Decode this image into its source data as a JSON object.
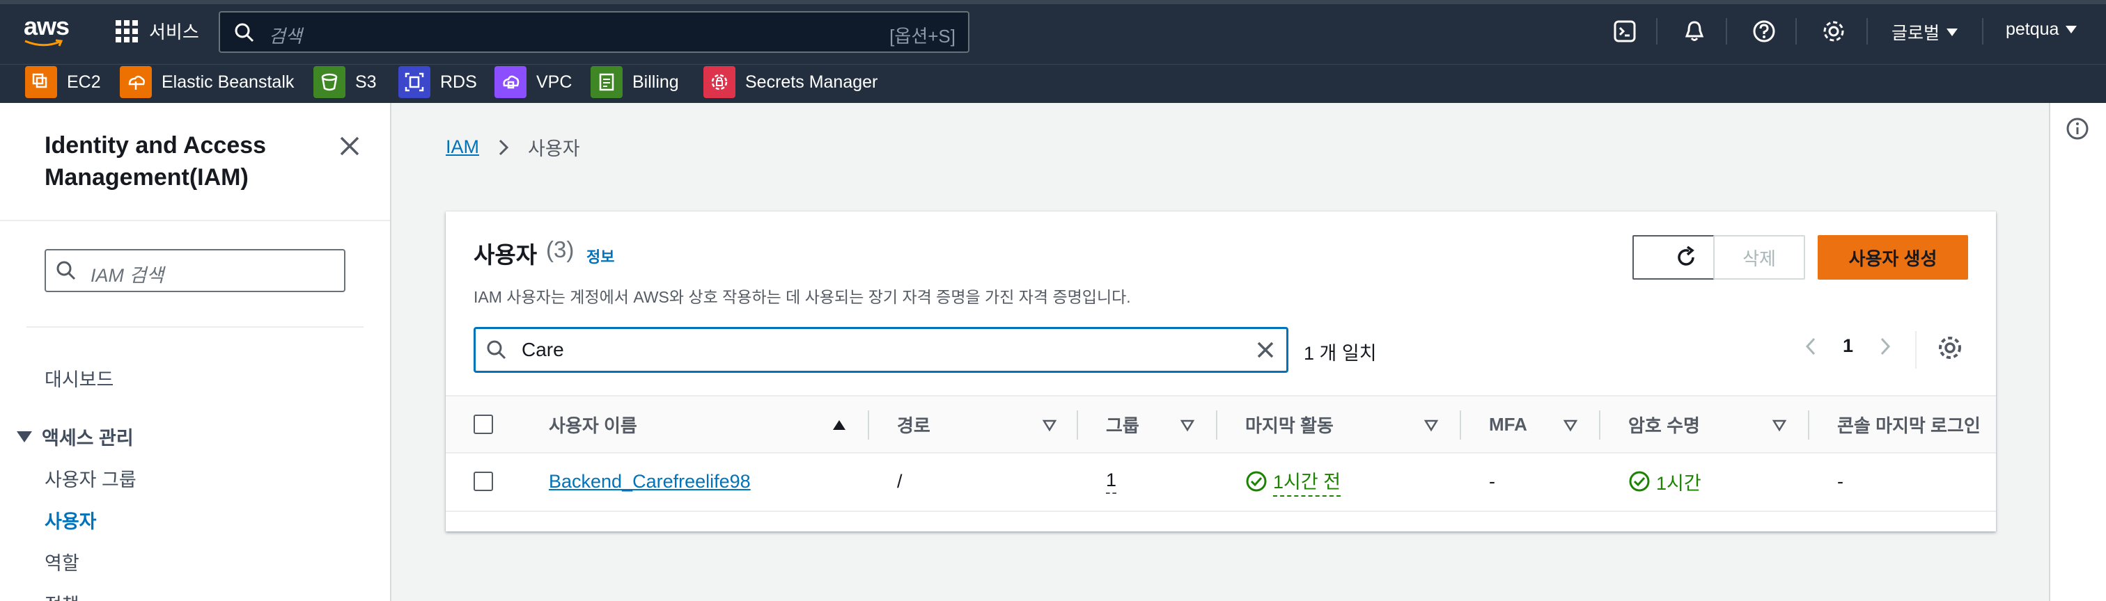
{
  "topnav": {
    "logo": "aws",
    "services_label": "서비스",
    "search_placeholder": "검색",
    "search_shortcut": "[옵션+S]",
    "region_label": "글로벌",
    "account_label": "petqua"
  },
  "favorites": [
    {
      "label": "EC2",
      "icon": "ec2-icon",
      "color": "#ed7100"
    },
    {
      "label": "Elastic Beanstalk",
      "icon": "elastic-beanstalk-icon",
      "color": "#ed7100"
    },
    {
      "label": "S3",
      "icon": "s3-icon",
      "color": "#3f8624"
    },
    {
      "label": "RDS",
      "icon": "rds-icon",
      "color": "#3b48cc"
    },
    {
      "label": "VPC",
      "icon": "vpc-icon",
      "color": "#8c4fff"
    },
    {
      "label": "Billing",
      "icon": "billing-icon",
      "color": "#3f8624"
    },
    {
      "label": "Secrets Manager",
      "icon": "secrets-manager-icon",
      "color": "#dd344c"
    }
  ],
  "sidebar": {
    "title": "Identity and Access Management(IAM)",
    "search_placeholder": "IAM 검색",
    "dashboard": "대시보드",
    "group_label": "액세스 관리",
    "items": [
      "사용자 그룹",
      "사용자",
      "역할",
      "정책"
    ]
  },
  "breadcrumb": {
    "root": "IAM",
    "current": "사용자"
  },
  "panel": {
    "title": "사용자",
    "count": "(3)",
    "info": "정보",
    "description": "IAM 사용자는 계정에서 AWS와 상호 작용하는 데 사용되는 장기 자격 증명을 가진 자격 증명입니다.",
    "delete_label": "삭제",
    "create_label": "사용자 생성",
    "filter_value": "Care",
    "match_text": "1 개 일치",
    "page": "1"
  },
  "table": {
    "columns": [
      "사용자 이름",
      "경로",
      "그룹",
      "마지막 활동",
      "MFA",
      "암호 수명",
      "콘솔 마지막 로그인"
    ],
    "rows": [
      {
        "username": "Backend_Carefreelife98",
        "path": "/",
        "groups": "1",
        "last_activity": "1시간 전",
        "mfa": "-",
        "password_age": "1시간",
        "console_last_login": "-"
      }
    ]
  },
  "colors": {
    "nav_bg": "#232f3e",
    "accent_orange": "#ec7211",
    "link_blue": "#0073bb",
    "success_green": "#1d8102"
  }
}
